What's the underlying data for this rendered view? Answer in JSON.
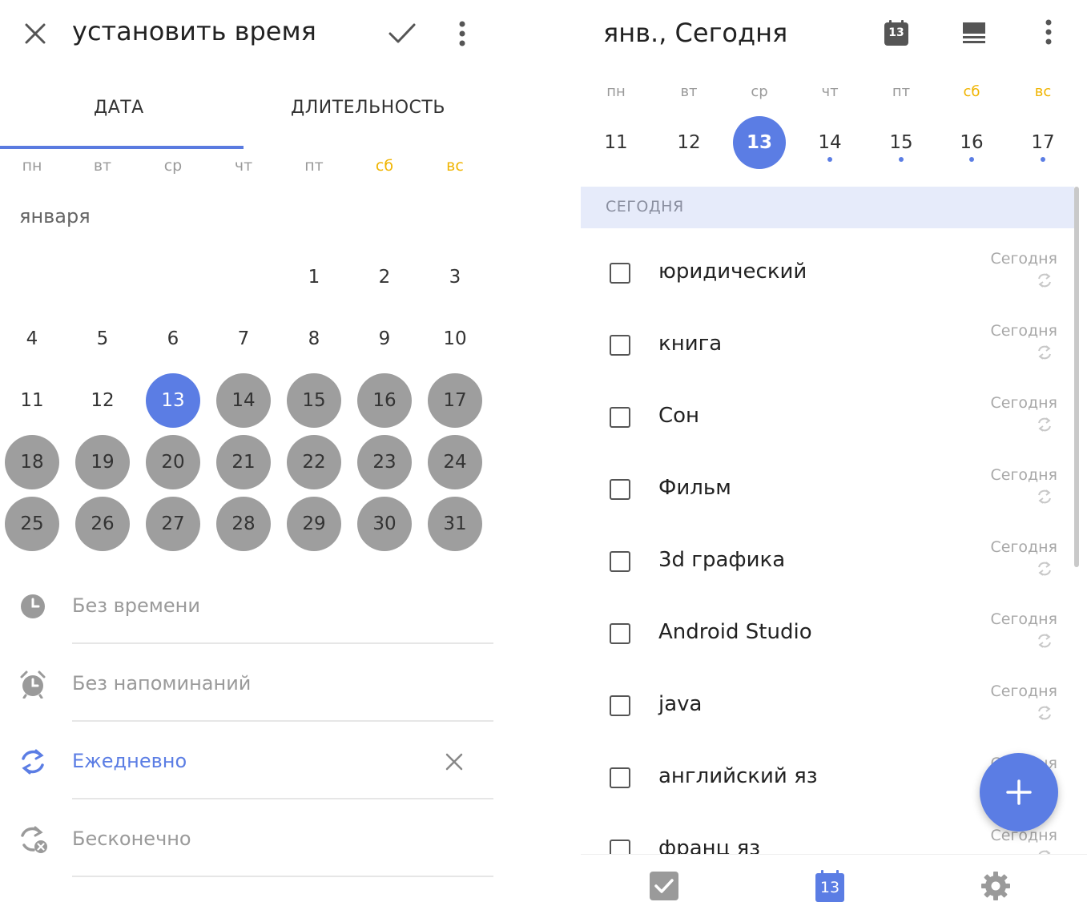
{
  "left": {
    "title": "установить время",
    "tabs": [
      "ДАТА",
      "ДЛИТЕЛЬНОСТЬ"
    ],
    "active_tab": 0,
    "weekdays": [
      "пн",
      "вт",
      "ср",
      "чт",
      "пт",
      "сб",
      "вс"
    ],
    "weekend_indices": [
      5,
      6
    ],
    "month": "января",
    "days": [
      "1",
      "2",
      "3",
      "4",
      "5",
      "6",
      "7",
      "8",
      "9",
      "10",
      "11",
      "12",
      "13",
      "14",
      "15",
      "16",
      "17",
      "18",
      "19",
      "20",
      "21",
      "22",
      "23",
      "24",
      "25",
      "26",
      "27",
      "28",
      "29",
      "30",
      "31"
    ],
    "first_weekday_index": 4,
    "selected_day": "13",
    "options": [
      {
        "label": "Без времени",
        "icon": "clock-icon",
        "active": false
      },
      {
        "label": "Без напоминаний",
        "icon": "alarm-icon",
        "active": false
      },
      {
        "label": "Ежедневно",
        "icon": "repeat-icon",
        "active": true
      },
      {
        "label": "Бесконечно",
        "icon": "repeat-end-icon",
        "active": false
      }
    ]
  },
  "right": {
    "title": "янв., Сегодня",
    "calendar_badge": "13",
    "weekdays": [
      "пн",
      "вт",
      "ср",
      "чт",
      "пт",
      "сб",
      "вс"
    ],
    "week_days": [
      "11",
      "12",
      "13",
      "14",
      "15",
      "16",
      "17"
    ],
    "selected_day": "13",
    "days_with_tasks": [
      "14",
      "15",
      "16",
      "17"
    ],
    "section_label": "СЕГОДНЯ",
    "tasks": [
      {
        "title": "юридический",
        "date": "Сегодня"
      },
      {
        "title": "книга",
        "date": "Сегодня"
      },
      {
        "title": "Сон",
        "date": "Сегодня"
      },
      {
        "title": "Фильм",
        "date": "Сегодня"
      },
      {
        "title": "3d  графика",
        "date": "Сегодня"
      },
      {
        "title": "Android  Studio",
        "date": "Сегодня"
      },
      {
        "title": "java",
        "date": "Сегодня"
      },
      {
        "title": "английский  яз",
        "date": "Сегодня"
      },
      {
        "title": "франц яз",
        "date": "Сегодня"
      }
    ],
    "bottom_nav": {
      "calendar_badge": "13"
    }
  },
  "colors": {
    "accent": "#5b7de4",
    "weekend": "#f0b400",
    "day_circle": "#9e9e9e",
    "section_bg": "#e6ebfa"
  }
}
